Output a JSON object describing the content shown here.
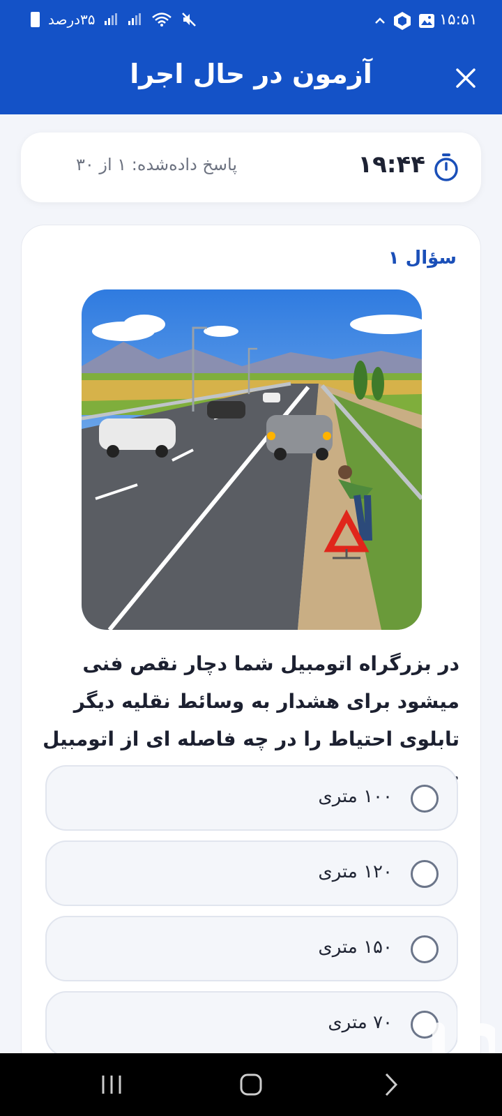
{
  "status_bar": {
    "time": "۱۵:۵۱",
    "battery_text": "۳۵درصد"
  },
  "header": {
    "title": "آزمون در حال اجرا",
    "close_icon": "close-icon",
    "background_color": "#1452c7"
  },
  "timer": {
    "value": "۱۹:۴۴",
    "answered_text": "پاسخ داده‌شده: ۱ از ۳۰",
    "icon": "stopwatch-icon"
  },
  "question": {
    "number_label": "سؤال ۱",
    "text": "در بزرگراه اتومبیل شما دچار نقص فنی میشود برای هشدار به وسائط نقلیه دیگر تابلوی احتیاط را در چه فاصله ای از اتومبیل خود قرار می دهید؟",
    "image": "roadside-warning-triangle-illustration"
  },
  "options": [
    {
      "label": "۱۰۰ متری"
    },
    {
      "label": "۱۲۰ متری"
    },
    {
      "label": "۱۵۰ متری"
    },
    {
      "label": "۷۰ متری"
    }
  ],
  "colors": {
    "accent": "#1452c7",
    "question_number": "#1a4fb8"
  }
}
